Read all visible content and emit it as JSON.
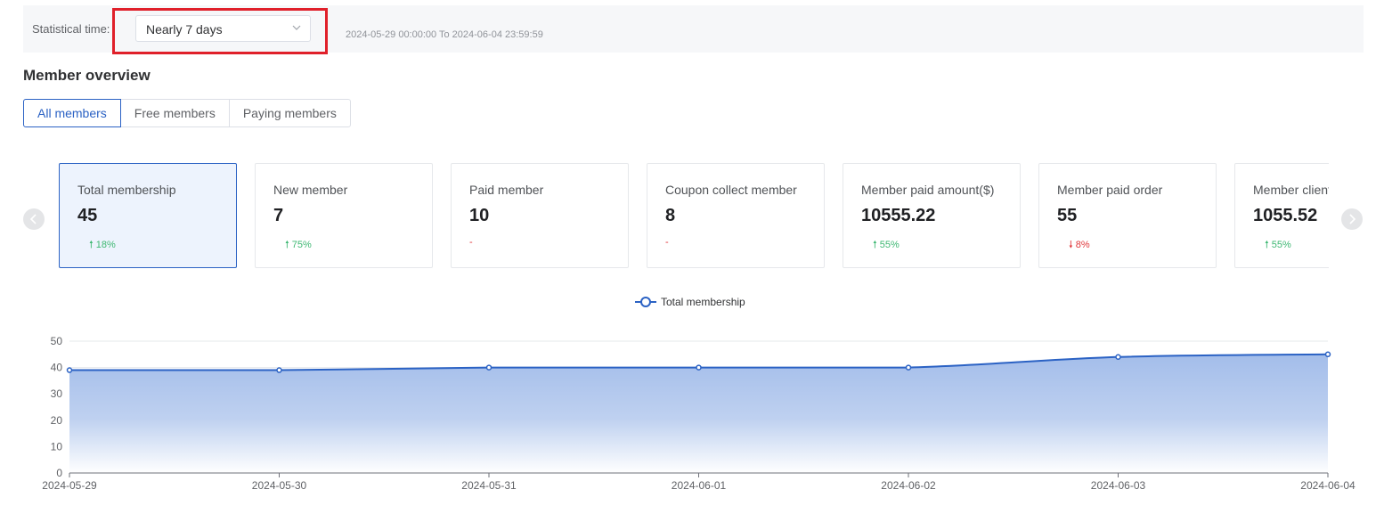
{
  "filter": {
    "label": "Statistical time:",
    "selected": "Nearly 7 days",
    "date_range": "2024-05-29 00:00:00 To 2024-06-04 23:59:59"
  },
  "overview": {
    "title": "Member overview",
    "tabs": [
      {
        "label": "All members",
        "active": true
      },
      {
        "label": "Free members",
        "active": false
      },
      {
        "label": "Paying members",
        "active": false
      }
    ]
  },
  "cards": [
    {
      "label": "Total membership",
      "value": "45",
      "trend": "18%",
      "direction": "up",
      "active": true
    },
    {
      "label": "New member",
      "value": "7",
      "trend": "75%",
      "direction": "up"
    },
    {
      "label": "Paid member",
      "value": "10",
      "trend": "-",
      "direction": "none"
    },
    {
      "label": "Coupon collect member",
      "value": "8",
      "trend": "-",
      "direction": "none"
    },
    {
      "label": "Member paid amount($)",
      "value": "10555.22",
      "trend": "55%",
      "direction": "up"
    },
    {
      "label": "Member paid order",
      "value": "55",
      "trend": "8%",
      "direction": "down"
    },
    {
      "label": "Member client",
      "value": "1055.52",
      "trend": "55%",
      "direction": "up"
    }
  ],
  "colors": {
    "accent": "#2b62c4",
    "up": "#3fb873",
    "down": "#e0373b",
    "highlight": "#e0202a"
  },
  "icons": {
    "prev": "chevron-left-icon",
    "next": "chevron-right-icon",
    "dropdown": "chevron-down-icon"
  },
  "chart_data": {
    "type": "area",
    "x": [
      "2024-05-29",
      "2024-05-30",
      "2024-05-31",
      "2024-06-01",
      "2024-06-02",
      "2024-06-03",
      "2024-06-04"
    ],
    "series": [
      {
        "name": "Total membership",
        "values": [
          39,
          39,
          40,
          40,
          40,
          44,
          45
        ]
      }
    ],
    "ylim": [
      0,
      50
    ],
    "yticks": [
      0,
      10,
      20,
      30,
      40,
      50
    ],
    "legend": "top-center",
    "grid": true,
    "smooth": true
  }
}
